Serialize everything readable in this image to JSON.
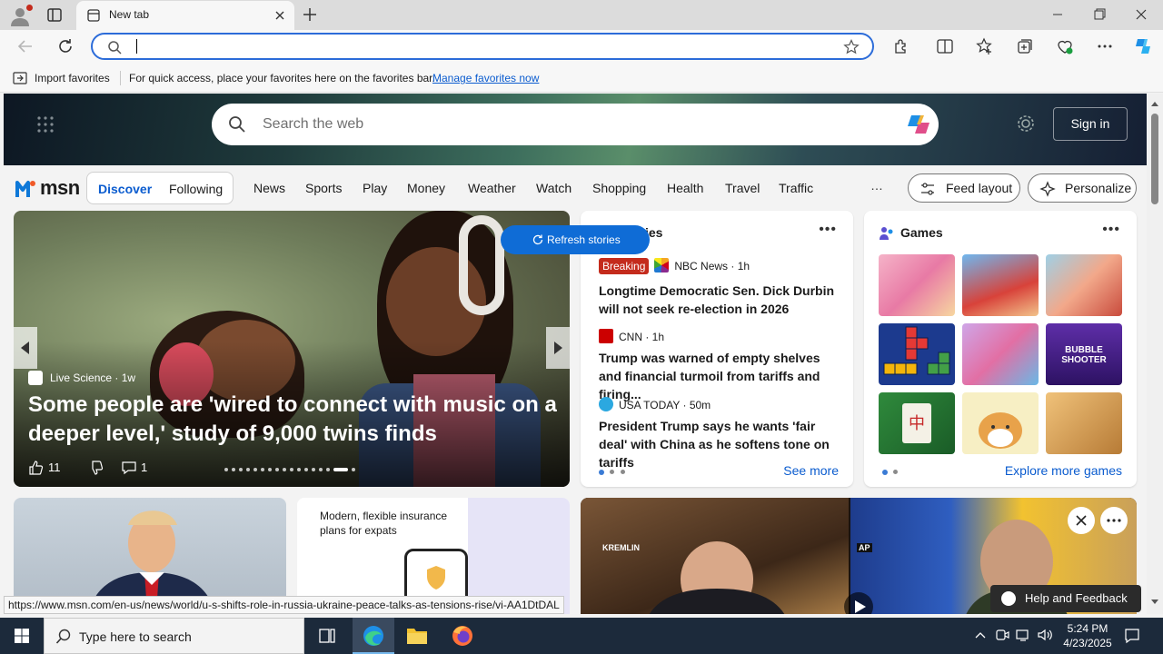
{
  "browser": {
    "tab_title": "New tab",
    "address_value": "",
    "favorites_bar": {
      "import_label": "Import favorites",
      "message": "For quick access, place your favorites here on the favorites bar.",
      "manage_link": "Manage favorites now"
    }
  },
  "msn": {
    "search_placeholder": "Search the web",
    "sign_in": "Sign in",
    "logo_text": "msn",
    "tabs": {
      "discover": "Discover",
      "following": "Following"
    },
    "categories": [
      "News",
      "Sports",
      "Play",
      "Money",
      "Weather",
      "Watch",
      "Shopping",
      "Health",
      "Travel",
      "Traffic"
    ],
    "more": "…",
    "feed_layout": "Feed layout",
    "personalize": "Personalize",
    "carousel": {
      "source": "Live Science",
      "age": "1w",
      "headline": "Some people are 'wired to connect with music on a deeper level,' study of 9,000 twins finds",
      "likes": "11",
      "comments": "1",
      "slide_count": 17,
      "active_slide": 15
    },
    "refresh_label": "Refresh stories",
    "top_stories": {
      "title": "Top stories",
      "stories": [
        {
          "badge": "Breaking",
          "source": "NBC News",
          "age": "1h",
          "title": "Longtime Democratic Sen. Dick Durbin will not seek re-election in 2026"
        },
        {
          "badge": "",
          "source": "CNN",
          "age": "1h",
          "title": "Trump was warned of empty shelves and financial turmoil from tariffs and firing..."
        },
        {
          "badge": "",
          "source": "USA TODAY",
          "age": "50m",
          "title": "President Trump says he wants 'fair deal' with China as he softens tone on tariffs"
        }
      ],
      "see_more": "See more"
    },
    "games": {
      "title": "Games",
      "explore": "Explore more games",
      "bubble_label": "BUBBLE SHOOTER"
    },
    "bottom": {
      "insurance_text": "Modern, flexible insurance plans for expats",
      "kremlin_tag": "KREMLIN",
      "ap_tag": "AP"
    },
    "feedback": "Help and Feedback"
  },
  "status_url": "https://www.msn.com/en-us/news/world/u-s-shifts-role-in-russia-ukraine-peace-talks-as-tensions-rise/vi-AA1DtDAL",
  "taskbar": {
    "search_placeholder": "Type here to search",
    "time": "5:24 PM",
    "date": "4/23/2025"
  },
  "colors": {
    "accent": "#0f6cd6",
    "breaking": "#c42b1c",
    "taskbar": "#1c2a3b",
    "link": "#0b5ccf"
  }
}
